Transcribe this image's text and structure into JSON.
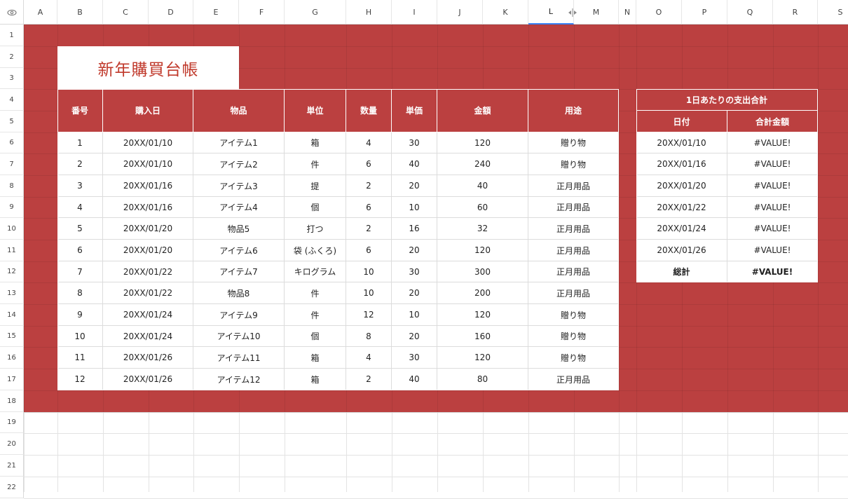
{
  "columns": [
    "A",
    "B",
    "C",
    "D",
    "E",
    "F",
    "G",
    "H",
    "I",
    "J",
    "K",
    "L",
    "M",
    "N",
    "O",
    "P",
    "Q",
    "R",
    "S"
  ],
  "rows": [
    "1",
    "2",
    "3",
    "4",
    "5",
    "6",
    "7",
    "8",
    "9",
    "10",
    "11",
    "12",
    "13",
    "14",
    "15",
    "16",
    "17",
    "18",
    "19",
    "20",
    "21",
    "22"
  ],
  "colors": {
    "accent": "#bb4040",
    "title_text": "#c0392b",
    "selection": "#3b82f6"
  },
  "title": "新年購買台帳",
  "purchase_table": {
    "headers": [
      "番号",
      "購入日",
      "物品",
      "単位",
      "数量",
      "単価",
      "金額",
      "用途"
    ],
    "rows": [
      [
        "1",
        "20XX/01/10",
        "アイテム1",
        "箱",
        "4",
        "30",
        "120",
        "贈り物"
      ],
      [
        "2",
        "20XX/01/10",
        "アイテム2",
        "件",
        "6",
        "40",
        "240",
        "贈り物"
      ],
      [
        "3",
        "20XX/01/16",
        "アイテム3",
        "提",
        "2",
        "20",
        "40",
        "正月用品"
      ],
      [
        "4",
        "20XX/01/16",
        "アイテム4",
        "個",
        "6",
        "10",
        "60",
        "正月用品"
      ],
      [
        "5",
        "20XX/01/20",
        "物品5",
        "打つ",
        "2",
        "16",
        "32",
        "正月用品"
      ],
      [
        "6",
        "20XX/01/20",
        "アイテム6",
        "袋 (ふくろ)",
        "6",
        "20",
        "120",
        "正月用品"
      ],
      [
        "7",
        "20XX/01/22",
        "アイテム7",
        "キログラム",
        "10",
        "30",
        "300",
        "正月用品"
      ],
      [
        "8",
        "20XX/01/22",
        "物品8",
        "件",
        "10",
        "20",
        "200",
        "正月用品"
      ],
      [
        "9",
        "20XX/01/24",
        "アイテム9",
        "件",
        "12",
        "10",
        "120",
        "贈り物"
      ],
      [
        "10",
        "20XX/01/24",
        "アイテム10",
        "個",
        "8",
        "20",
        "160",
        "贈り物"
      ],
      [
        "11",
        "20XX/01/26",
        "アイテム11",
        "箱",
        "4",
        "30",
        "120",
        "贈り物"
      ],
      [
        "12",
        "20XX/01/26",
        "アイテム12",
        "箱",
        "2",
        "40",
        "80",
        "正月用品"
      ]
    ]
  },
  "summary_table": {
    "title": "1日あたりの支出合計",
    "headers": [
      "日付",
      "合計金額"
    ],
    "rows": [
      [
        "20XX/01/10",
        "#VALUE!"
      ],
      [
        "20XX/01/16",
        "#VALUE!"
      ],
      [
        "20XX/01/20",
        "#VALUE!"
      ],
      [
        "20XX/01/22",
        "#VALUE!"
      ],
      [
        "20XX/01/24",
        "#VALUE!"
      ],
      [
        "20XX/01/26",
        "#VALUE!"
      ]
    ],
    "total": [
      "総計",
      "#VALUE!"
    ]
  },
  "icons": {
    "corner": "eye-icon",
    "resize": "column-resize-icon"
  }
}
